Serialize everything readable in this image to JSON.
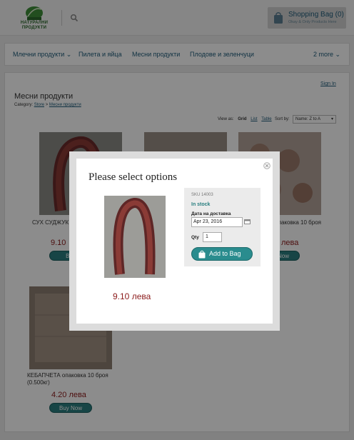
{
  "header": {
    "logo_text": "НАТУРАЛНИ ПРОДУКТИ",
    "bag_title": "Shopping Bag",
    "bag_count": "(0)",
    "bag_sub": "Okay & Only Products Here"
  },
  "nav": {
    "items": [
      "Млечни продукти",
      "Пилета и яйца",
      "Месни продукти",
      "Плодове и зеленчуци"
    ],
    "more": "2 more"
  },
  "page": {
    "signin": "Sign In",
    "title": "Месни продукти",
    "category_label": "Category:",
    "crumb_store": "Store",
    "crumb_sep": ">",
    "crumb_current": "Месни продукти",
    "view_as": "View as:",
    "view_grid": "Grid",
    "view_list": "List",
    "view_table": "Table",
    "sort_by": "Sort by:",
    "sort_value": "Name: Z to A"
  },
  "products": [
    {
      "name": "СУХ СУДЖУК подкова около",
      "price": "9.10",
      "buy": "Buy"
    },
    {
      "name": "",
      "price": "",
      "buy": ""
    },
    {
      "name": "опаковка 10 броя",
      "price": "лева",
      "buy": "Now"
    },
    {
      "name": "КЕБАПЧЕТА опаковка 10 броя (0.500кг)",
      "price": "4.20 лева",
      "buy": "Buy Now"
    }
  ],
  "modal": {
    "title": "Please select options",
    "price": "9.10 лева",
    "sku": "SKU 14003",
    "stock": "In stock",
    "date_label": "Дата на доставка",
    "date_value": "Apr 23, 2016",
    "qty_label": "Qty",
    "qty_value": "1",
    "add_button": "Add to Bag"
  },
  "colors": {
    "accent": "#2a7f80",
    "price": "#8b1a1a",
    "link": "#1f5c7a"
  }
}
